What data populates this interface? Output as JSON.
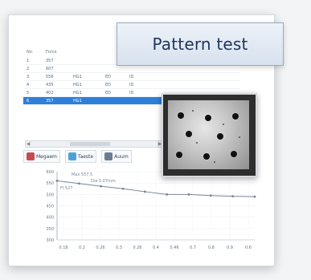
{
  "overlay": {
    "title": "Pattern test"
  },
  "table": {
    "headers": [
      "No.",
      "Force"
    ],
    "rows": [
      {
        "no": "1",
        "force": "357",
        "unit": "",
        "a": "",
        "b": ""
      },
      {
        "no": "2",
        "force": "607",
        "unit": "",
        "a": "",
        "b": ""
      },
      {
        "no": "3",
        "force": "556",
        "unit": "HG1",
        "a": "ED",
        "b": "ID"
      },
      {
        "no": "4",
        "force": "435",
        "unit": "HG1",
        "a": "ED",
        "b": "ID"
      },
      {
        "no": "5",
        "force": "402",
        "unit": "HG1",
        "a": "ED",
        "b": "ID"
      },
      {
        "no": "6",
        "force": "357",
        "unit": "HG1",
        "a": "",
        "b": ""
      }
    ],
    "selected_index": 5
  },
  "tabs": [
    {
      "label": "Megaem",
      "icon": "graph-icon",
      "color": "#c84b4b"
    },
    {
      "label": "Taeste",
      "icon": "pattern-icon",
      "color": "#4da0d7"
    },
    {
      "label": "Auum",
      "icon": "window-icon",
      "color": "#6a7c92"
    }
  ],
  "chart_data": {
    "type": "line",
    "x": [
      0.1,
      0.2,
      0.3,
      0.4,
      0.5,
      0.6,
      0.7,
      0.8,
      0.9,
      1.0
    ],
    "series": [
      {
        "values": [
          560,
          548,
          536,
          525,
          512,
          500,
          500,
          495,
          492,
          490
        ]
      }
    ],
    "annotations": [
      "Max 557.5",
      "Dia 0.07mm",
      "Fl 527"
    ],
    "xticks": [
      "0.18",
      "0.2",
      "0.26",
      "0.3",
      "0.26",
      "0.4",
      "0.46",
      "0.7",
      "0.8",
      "0.9",
      "0.6"
    ],
    "yticks": [
      "600",
      "550",
      "500",
      "450",
      "400",
      "350",
      "300"
    ],
    "ylim": [
      300,
      600
    ],
    "xlim": [
      0.1,
      1.0
    ],
    "grid": true,
    "line_color": "#7a8597"
  }
}
